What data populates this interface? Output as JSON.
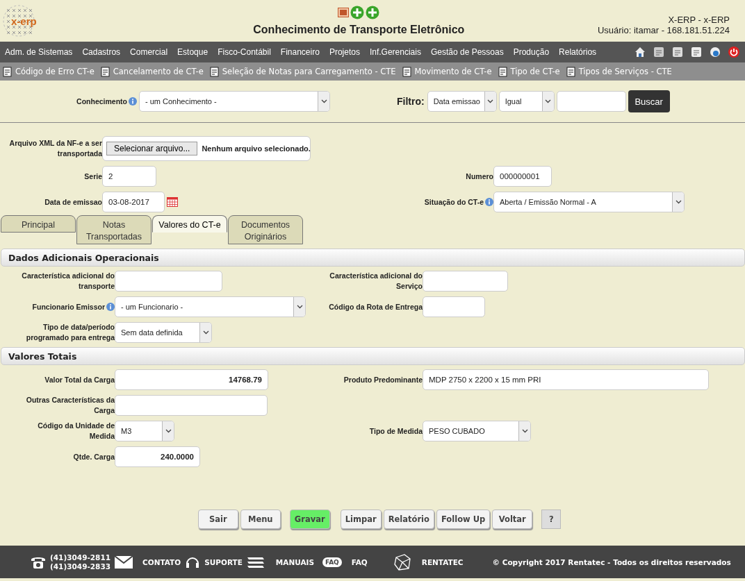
{
  "header": {
    "title": "Conhecimento de Transporte Eletrônico",
    "logo_text": "x-erp",
    "system": "X-ERP - x-ERP",
    "user": "Usuário: itamar - 168.181.51.224"
  },
  "menu": [
    "Adm. de Sistemas",
    "Cadastros",
    "Comercial",
    "Estoque",
    "Fisco-Contábil",
    "Financeiro",
    "Projetos",
    "Inf.Gerenciais",
    "Gestão de Pessoas",
    "Produção",
    "Relatórios"
  ],
  "shortcuts": [
    "Código de Erro CT-e",
    "Cancelamento de CT-e",
    "Seleção de Notas para Carregamento - CTE",
    "Movimento de CT-e",
    "Tipo de CT-e",
    "Tipos de Serviços - CTE"
  ],
  "search": {
    "label": "Conhecimento",
    "select": "- um Conhecimento -",
    "filter_label": "Filtro:",
    "filter_field": "Data emissao",
    "filter_op": "Igual",
    "button": "Buscar"
  },
  "form": {
    "rows": [
      {
        "left": {
          "label": "Arquivo XML da NF-e a ser transportada",
          "kind": "file",
          "button": "Selecionar arquivo...",
          "value": "Nenhum arquivo selecionado."
        }
      },
      {
        "left": {
          "label": "Serie",
          "kind": "text",
          "value": "2"
        },
        "right": {
          "label": "Numero",
          "kind": "text",
          "value": "000000001"
        }
      },
      {
        "left": {
          "label": "Data de emissao",
          "kind": "date",
          "value": "03-08-2017"
        },
        "right": {
          "label": "Situação do CT-e",
          "info": true,
          "kind": "select",
          "value": "Aberta / Emissão Normal - A"
        }
      }
    ]
  },
  "tabs": [
    {
      "label": "Principal",
      "selected": false
    },
    {
      "label": "Notas Transportadas",
      "selected": false
    },
    {
      "label": "Valores do CT-e",
      "selected": true
    },
    {
      "label": "Documentos Originários",
      "selected": false
    }
  ],
  "sections": [
    {
      "title": "Dados Adicionais Operacionais",
      "rows": [
        {
          "left": {
            "label": "Característica adicional do transporte",
            "kind": "text"
          },
          "right": {
            "label": "Característica adicional do Serviço",
            "kind": "text"
          }
        },
        {
          "left": {
            "label": "Funcionario Emissor",
            "info": true,
            "kind": "select",
            "value": "- um Funcionario -"
          },
          "right": {
            "label": "Código da Rota de Entrega",
            "kind": "text"
          }
        },
        {
          "left": {
            "label": "Tipo de data/período programado para entrega",
            "kind": "select",
            "value": "Sem data definida"
          }
        }
      ]
    },
    {
      "title": "Valores Totais",
      "rows": [
        {
          "left": {
            "label": "Valor Total da Carga",
            "kind": "number",
            "value": "14768.79"
          },
          "right": {
            "label": "Produto Predominante",
            "kind": "text",
            "value": "MDP 2750 x 2200 x 15 mm PRI"
          }
        },
        {
          "left": {
            "label": "Outras Características da Carga",
            "kind": "text"
          }
        },
        {
          "left": {
            "label": "Código da Unidade de Medida",
            "kind": "select",
            "value": "M3"
          },
          "right": {
            "label": "Tipo de Medida",
            "kind": "select",
            "value": "PESO CUBADO"
          }
        },
        {
          "left": {
            "label": "Qtde. Carga",
            "kind": "number",
            "value": "240.0000"
          }
        }
      ]
    }
  ],
  "actions": [
    {
      "label": "Sair",
      "kind": "normal"
    },
    {
      "label": "Menu",
      "kind": "normal"
    },
    {
      "label": "Gravar",
      "kind": "primary"
    },
    {
      "label": "Limpar",
      "kind": "normal"
    },
    {
      "label": "Relatório",
      "kind": "normal"
    },
    {
      "label": "Follow Up",
      "kind": "normal"
    },
    {
      "label": "Voltar",
      "kind": "normal"
    },
    {
      "label": "?",
      "kind": "help"
    }
  ],
  "footer": {
    "phones": [
      "(41)3049-2811",
      "(41)3049-2833"
    ],
    "contact": "CONTATO",
    "support": "SUPORTE",
    "manuals": "MANUAIS",
    "faq_icon": "FAQ",
    "faq": "FAQ",
    "company": "RENTATEC",
    "copyright": "© Copyright 2017 Rentatec - Todos os direitos reservados"
  }
}
